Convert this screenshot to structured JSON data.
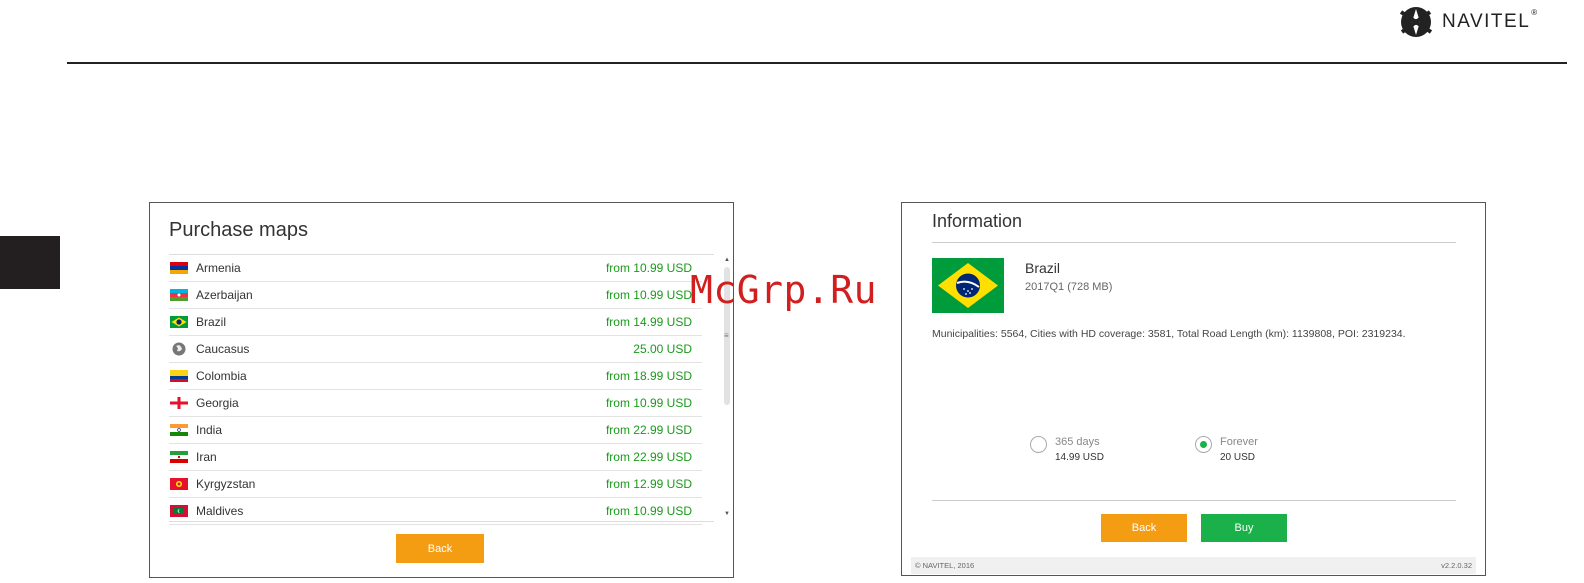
{
  "brand": {
    "name": "NAVITEL",
    "reg": "®"
  },
  "watermark": "McGrp.Ru",
  "purchase": {
    "title": "Purchase maps",
    "back_label": "Back",
    "countries": [
      {
        "name": "Armenia",
        "price": "from 10.99 USD",
        "flag": "armenia-flag-icon"
      },
      {
        "name": "Azerbaijan",
        "price": "from 10.99 USD",
        "flag": "azerbaijan-flag-icon"
      },
      {
        "name": "Brazil",
        "price": "from 14.99 USD",
        "flag": "brazil-flag-icon"
      },
      {
        "name": "Caucasus",
        "price": "25.00 USD",
        "flag": "globe-icon"
      },
      {
        "name": "Colombia",
        "price": "from 18.99 USD",
        "flag": "colombia-flag-icon"
      },
      {
        "name": "Georgia",
        "price": "from 10.99 USD",
        "flag": "georgia-flag-icon"
      },
      {
        "name": "India",
        "price": "from 22.99 USD",
        "flag": "india-flag-icon"
      },
      {
        "name": "Iran",
        "price": "from 22.99 USD",
        "flag": "iran-flag-icon"
      },
      {
        "name": "Kyrgyzstan",
        "price": "from 12.99 USD",
        "flag": "kyrgyzstan-flag-icon"
      },
      {
        "name": "Maldives",
        "price": "from 10.99 USD",
        "flag": "maldives-flag-icon"
      }
    ]
  },
  "info": {
    "title": "Information",
    "map_name": "Brazil",
    "map_version": "2017Q1 (728 MB)",
    "stats": "Municipalities: 5564, Cities with HD coverage: 3581, Total Road Length (km): 1139808, POI: 2319234.",
    "options": [
      {
        "label": "365 days",
        "price": "14.99 USD",
        "selected": false
      },
      {
        "label": "Forever",
        "price": "20 USD",
        "selected": true
      }
    ],
    "back_label": "Back",
    "buy_label": "Buy",
    "copyright": "© NAVITEL, 2016",
    "version": "v2.2.0.32"
  },
  "colors": {
    "accent_orange": "#f59d12",
    "accent_green": "#1ab04a",
    "price_green": "#1a9a1a",
    "watermark_red": "#d11e1e"
  }
}
